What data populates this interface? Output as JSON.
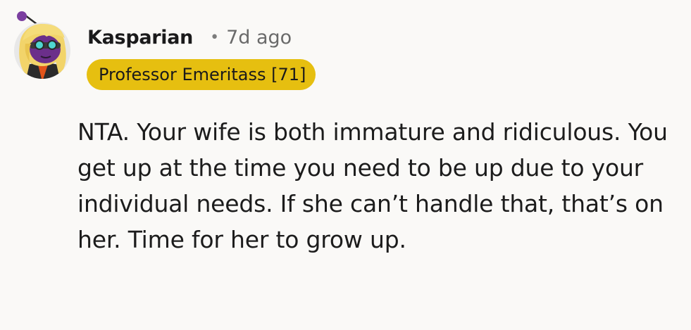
{
  "comment": {
    "author": {
      "avatar_icon": "avatar-character-icon",
      "username": "Kasparian"
    },
    "separator": "•",
    "timestamp": "7d ago",
    "flair": {
      "text": "Professor Emeritass [71]",
      "color": "#e6bf10"
    },
    "body": "NTA. Your wife is both immature and ridiculous. You get up at the time you need to be up due to your individual needs. If she can’t handle that, that’s on her. Time for her to grow up."
  }
}
